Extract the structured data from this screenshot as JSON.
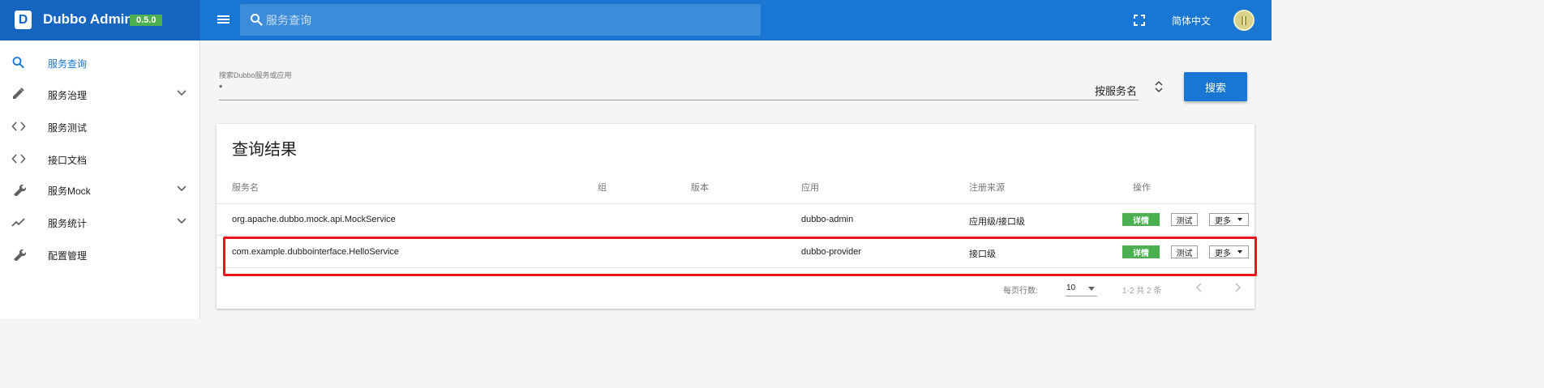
{
  "brand": {
    "logo_letter": "D",
    "title": "Dubbo Admin",
    "version": "0.5.0"
  },
  "topbar": {
    "menu_icon": "menu-icon",
    "search_placeholder": "服务查询",
    "fullscreen_icon": "fullscreen-icon",
    "language": "简体中文",
    "avatar_icon": "user-avatar"
  },
  "sidebar": {
    "items": [
      {
        "label": "服务查询",
        "icon": "search-icon",
        "active": true,
        "expandable": false
      },
      {
        "label": "服务治理",
        "icon": "pencil-icon",
        "active": false,
        "expandable": true
      },
      {
        "label": "服务测试",
        "icon": "code-icon",
        "active": false,
        "expandable": false
      },
      {
        "label": "接口文档",
        "icon": "code-icon",
        "active": false,
        "expandable": false
      },
      {
        "label": "服务Mock",
        "icon": "wrench-icon",
        "active": false,
        "expandable": true
      },
      {
        "label": "服务统计",
        "icon": "trending-icon",
        "active": false,
        "expandable": true
      },
      {
        "label": "配置管理",
        "icon": "wrench-icon",
        "active": false,
        "expandable": false
      }
    ]
  },
  "search": {
    "label": "搜索Dubbo服务或应用",
    "value": "*",
    "type_selected": "按服务名",
    "button_label": "搜索"
  },
  "results": {
    "title": "查询结果",
    "headers": {
      "service": "服务名",
      "group": "组",
      "version": "版本",
      "app": "应用",
      "source": "注册来源",
      "actions": "操作"
    },
    "rows": [
      {
        "service": "org.apache.dubbo.mock.api.MockService",
        "group": "",
        "version": "",
        "app": "dubbo-admin",
        "source": "应用级/接口级",
        "detail_label": "详情",
        "test_label": "测试",
        "more_label": "更多"
      },
      {
        "service": "com.example.dubbointerface.HelloService",
        "group": "",
        "version": "",
        "app": "dubbo-provider",
        "source": "接口级",
        "detail_label": "详情",
        "test_label": "测试",
        "more_label": "更多",
        "highlighted": true
      }
    ],
    "pagination": {
      "rows_per_page_label": "每页行数:",
      "rows_per_page": "10",
      "info": "1-2 共 2 条"
    }
  },
  "colors": {
    "appbar": "#1976d2",
    "brand_bar": "#1565c0",
    "version_badge": "#4caf50",
    "detail_button": "#4caf50",
    "highlight_box": "#e6161b",
    "active_nav": "#1976d2"
  }
}
